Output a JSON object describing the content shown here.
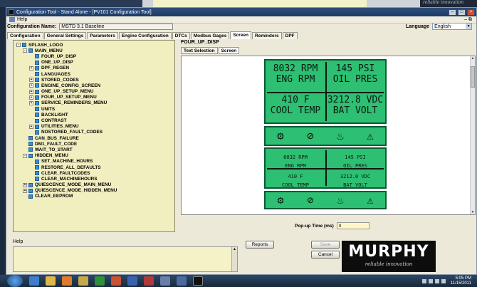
{
  "window": {
    "title": "Configuration Tool - Stand Alone - [PV101 Configuration Tool]",
    "menu_help": "Help"
  },
  "bg_tagline": "reliable innovation",
  "config": {
    "name_label": "Configuration Name:",
    "name_value": "MSTD 3.1 Baseline",
    "language_label": "Language",
    "language_value": "English"
  },
  "tabs": [
    "Configuration",
    "General Settings",
    "Parameters",
    "Engine Configuration",
    "DTCs",
    "Modbus Gages",
    "Screen",
    "Reminders",
    "DPF"
  ],
  "tree": [
    {
      "label": "SPLASH_LOGO",
      "level": 0,
      "exp": "-"
    },
    {
      "label": "MAIN_MENU",
      "level": 1,
      "exp": "-"
    },
    {
      "label": "FOUR_UP_DISP",
      "level": 2,
      "exp": ""
    },
    {
      "label": "ONE_UP_DISP",
      "level": 2,
      "exp": ""
    },
    {
      "label": "DPF_REGEN",
      "level": 2,
      "exp": "+"
    },
    {
      "label": "LANGUAGES",
      "level": 2,
      "exp": ""
    },
    {
      "label": "STORED_CODES",
      "level": 2,
      "exp": "+"
    },
    {
      "label": "ENGINE_CONFIG_SCREEN",
      "level": 2,
      "exp": "+"
    },
    {
      "label": "ONE_UP_SETUP_MENU",
      "level": 2,
      "exp": "+"
    },
    {
      "label": "FOUR_UP_SETUP_MENU",
      "level": 2,
      "exp": "+"
    },
    {
      "label": "SERVICE_REMINDERS_MENU",
      "level": 2,
      "exp": "+"
    },
    {
      "label": "UNITS",
      "level": 2,
      "exp": ""
    },
    {
      "label": "BACKLIGHT",
      "level": 2,
      "exp": ""
    },
    {
      "label": "CONTRAST",
      "level": 2,
      "exp": ""
    },
    {
      "label": "UTILITIES_MENU",
      "level": 2,
      "exp": "+"
    },
    {
      "label": "NOSTORED_FAULT_CODES",
      "level": 2,
      "exp": ""
    },
    {
      "label": "CAN_BUS_FAILURE",
      "level": 1,
      "exp": ""
    },
    {
      "label": "DM1_FAULT_CODE",
      "level": 1,
      "exp": ""
    },
    {
      "label": "WAIT_TO_START",
      "level": 1,
      "exp": ""
    },
    {
      "label": "HIDDEN_MENU",
      "level": 1,
      "exp": "-"
    },
    {
      "label": "SET_MACHINE_HOURS",
      "level": 2,
      "exp": ""
    },
    {
      "label": "RESTORE_ALL_DEFAULTS",
      "level": 2,
      "exp": ""
    },
    {
      "label": "CLEAR_FAULTCODES",
      "level": 2,
      "exp": ""
    },
    {
      "label": "CLEAR_MACHINEHOURS",
      "level": 2,
      "exp": ""
    },
    {
      "label": "QUIESCENCE_MODE_MAIN_MENU",
      "level": 1,
      "exp": "+"
    },
    {
      "label": "QUIESCENCE_MODE_HIDDEN_MENU",
      "level": 1,
      "exp": "+"
    },
    {
      "label": "CLEAR_EEPROM",
      "level": 1,
      "exp": ""
    }
  ],
  "panel": {
    "title": "FOUR_UP_DISP",
    "subtabs": [
      "Text Selection",
      "Screen"
    ]
  },
  "display": {
    "big": [
      {
        "value": "8032 RPM",
        "label": "ENG RPM"
      },
      {
        "value": "145 PSI",
        "label": "OIL PRES"
      },
      {
        "value": "410 F",
        "label": "COOL TEMP"
      },
      {
        "value": "3212.8 VDC",
        "label": "BAT VOLT"
      }
    ],
    "small": [
      {
        "value": "8032 RPM",
        "label": "ENG RPM"
      },
      {
        "value": "145 PSI",
        "label": "OIL PRES"
      },
      {
        "value": "410 F",
        "label": "COOL TEMP"
      },
      {
        "value": "3212.0 VDC",
        "label": "BAT VOLT"
      }
    ],
    "icons": [
      "engine-light-icon",
      "dpf-inhibit-icon",
      "dpf-regen-icon",
      "warning-icon"
    ]
  },
  "popup": {
    "label": "Pop-up Time (ms)",
    "value": "0"
  },
  "help": {
    "label": "Help"
  },
  "buttons": {
    "reports": "Reports",
    "save": "Save",
    "cancel": "Cancel"
  },
  "logo": {
    "name": "MURPHY",
    "tagline": "reliable innovation"
  },
  "taskbar": {
    "time": "5:05 PM",
    "date": "11/15/2011"
  },
  "colors": {
    "lcd_green": "#2dbf72",
    "lcd_border": "#0b5a33",
    "tree_bg": "#f1eebf"
  }
}
